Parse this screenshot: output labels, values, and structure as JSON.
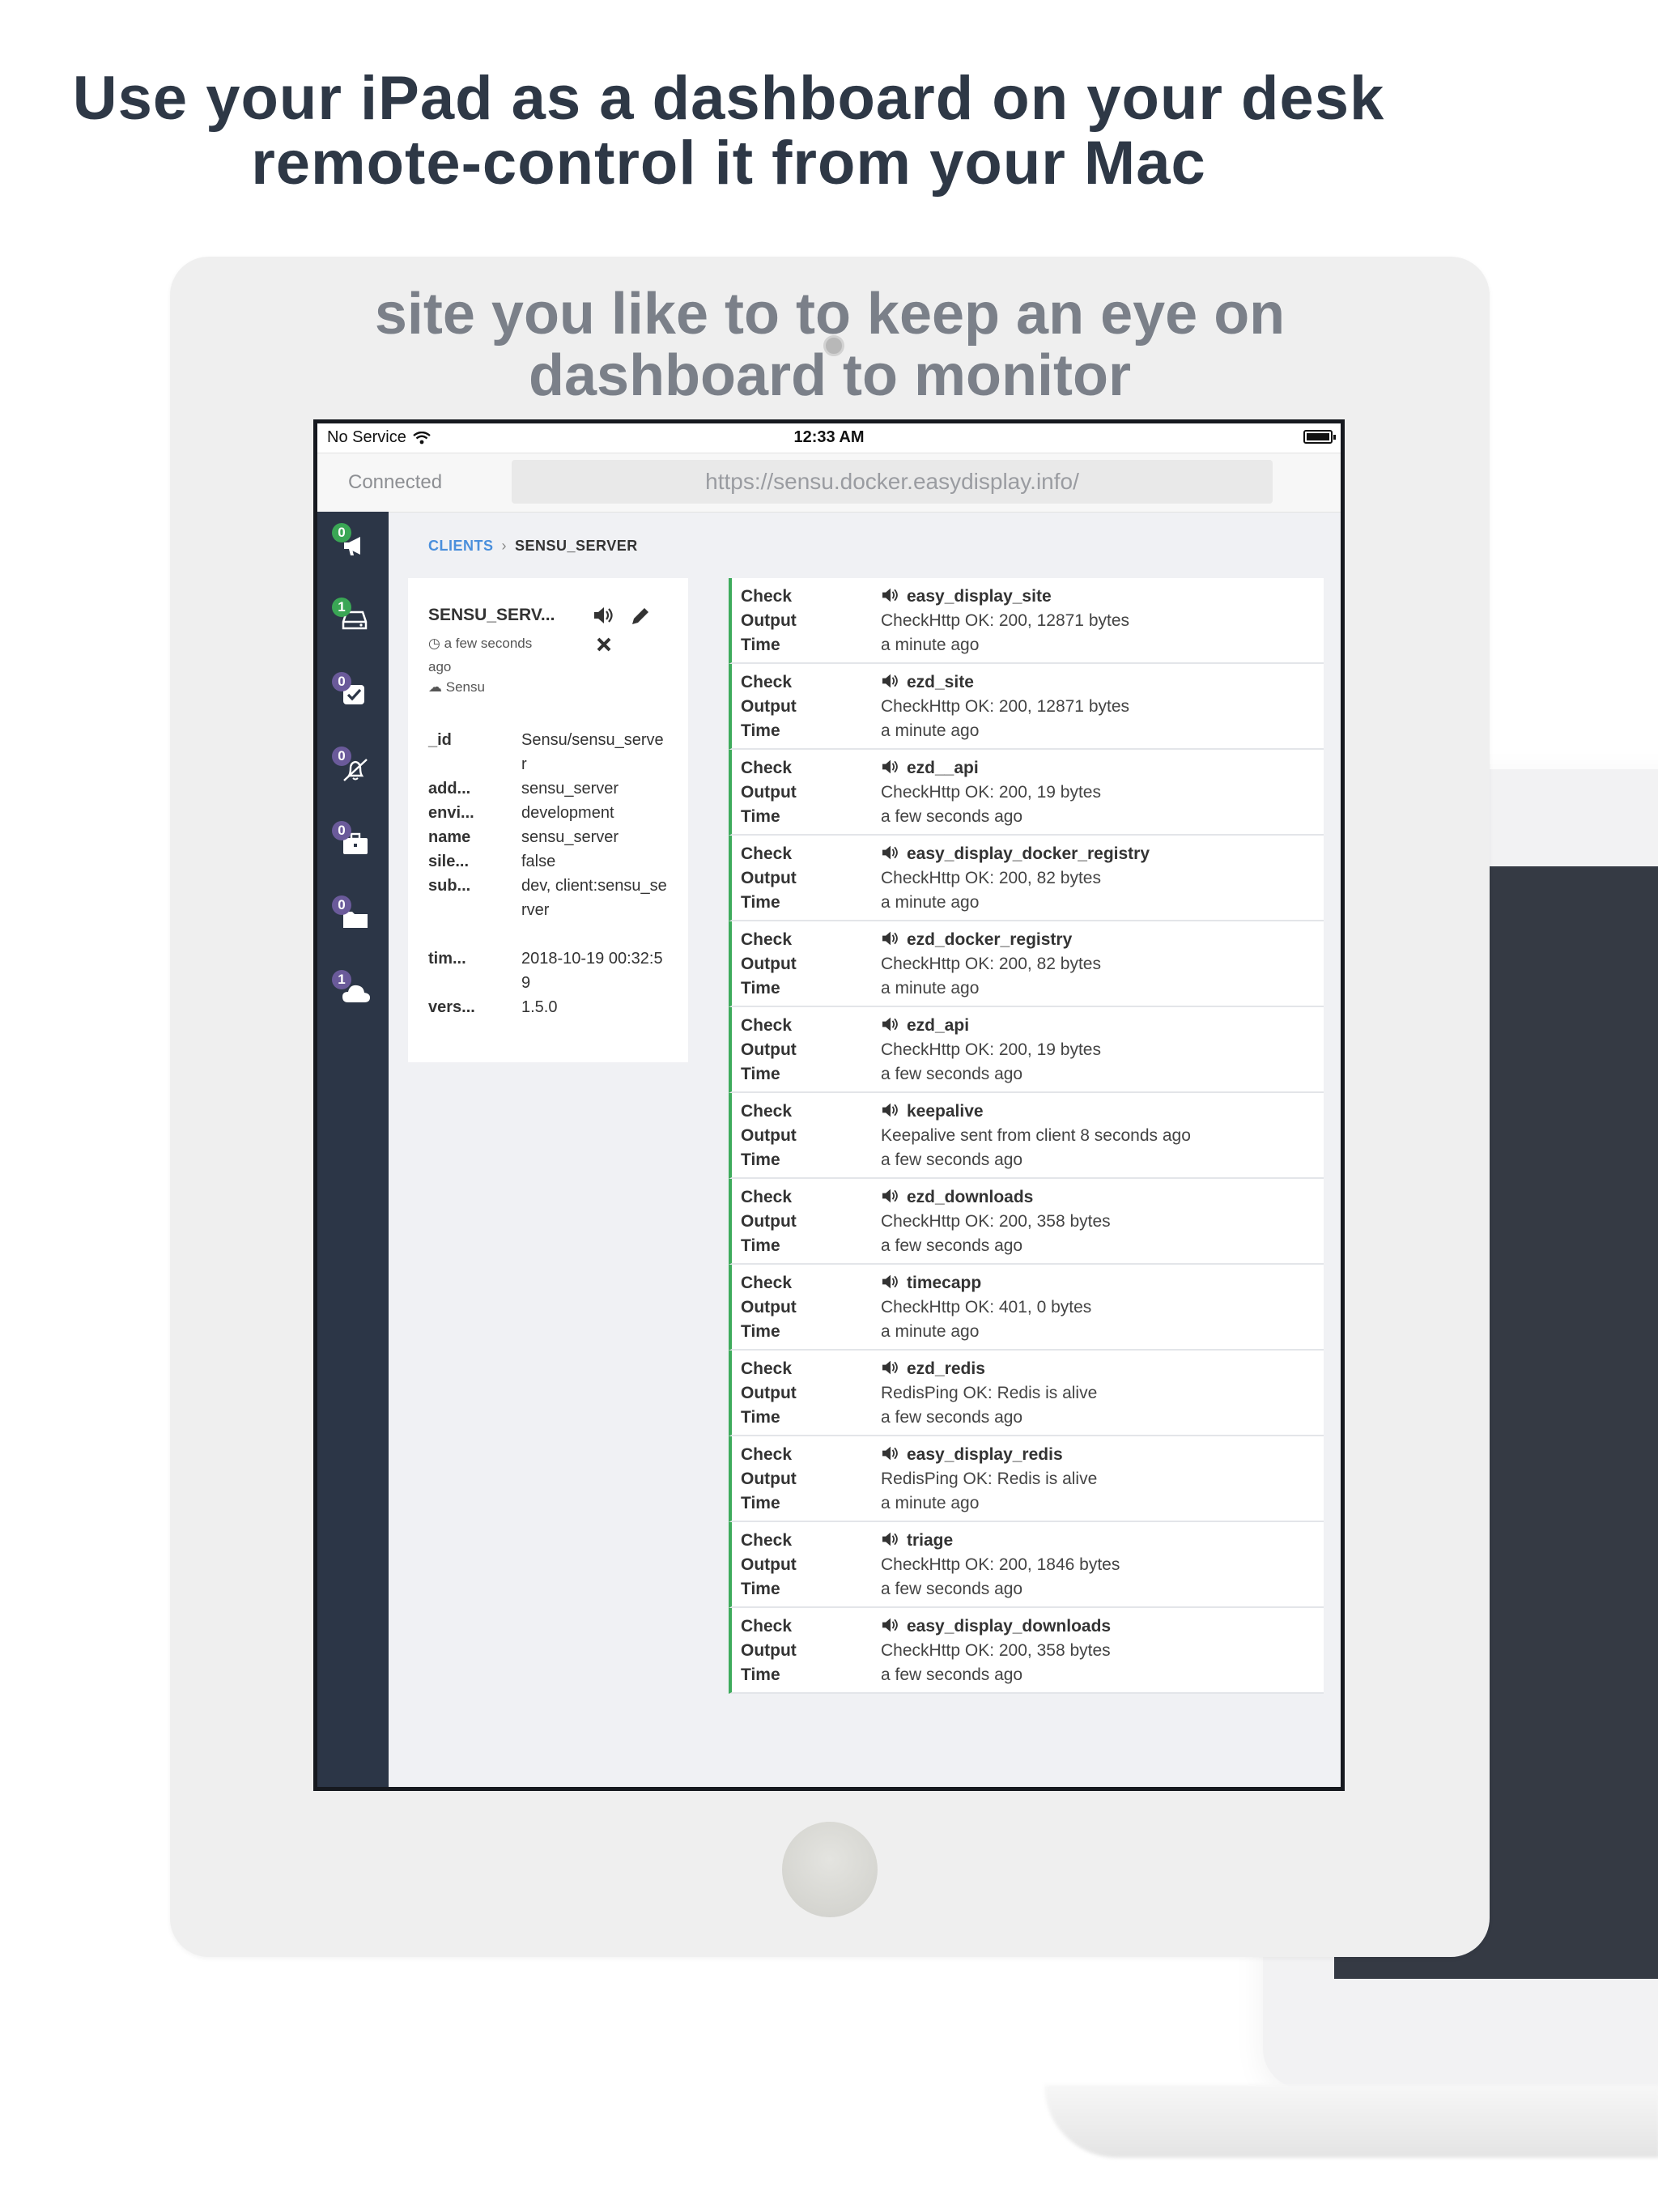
{
  "headline": {
    "line1": "Use your iPad as a dashboard on your desk",
    "line2": "remote-control it from your Mac"
  },
  "tagline": {
    "line1": "site you like to to keep an eye on",
    "line2": "dashboard to monitor"
  },
  "statusbar": {
    "carrier": "No Service",
    "time": "12:33 AM"
  },
  "browser": {
    "connection": "Connected",
    "url": "https://sensu.docker.easydisplay.info/"
  },
  "sidebar": {
    "items": [
      {
        "icon": "megaphone-icon",
        "badge": "0",
        "badge_color": "#3aa655"
      },
      {
        "icon": "hard-drive-icon",
        "badge": "1",
        "badge_color": "#3aa655"
      },
      {
        "icon": "checkbox-icon",
        "badge": "0",
        "badge_color": "#6a5a9a"
      },
      {
        "icon": "bell-slash-icon",
        "badge": "0",
        "badge_color": "#6a5a9a"
      },
      {
        "icon": "briefcase-icon",
        "badge": "0",
        "badge_color": "#6a5a9a"
      },
      {
        "icon": "folder-icon",
        "badge": "0",
        "badge_color": "#6a5a9a"
      },
      {
        "icon": "cloud-icon",
        "badge": "1",
        "badge_color": "#6a5a9a"
      }
    ]
  },
  "breadcrumb": {
    "parent": "CLIENTS",
    "current": "SENSU_SERVER"
  },
  "client": {
    "name": "SENSU_SERV...",
    "last_seen": "a few seconds ago",
    "source": "Sensu",
    "fields": [
      {
        "key": "_id",
        "value": "Sensu/sensu_server"
      },
      {
        "key": "add...",
        "value": "sensu_server"
      },
      {
        "key": "envi...",
        "value": "development"
      },
      {
        "key": "name",
        "value": "sensu_server"
      },
      {
        "key": "sile...",
        "value": "false"
      },
      {
        "key": "sub...",
        "value": "dev, client:sensu_server"
      },
      {
        "key": "tim...",
        "value": "2018-10-19 00:32:59"
      },
      {
        "key": "vers...",
        "value": "1.5.0"
      }
    ]
  },
  "check_labels": {
    "check": "Check",
    "output": "Output",
    "time": "Time"
  },
  "checks": [
    {
      "name": "easy_display_site",
      "output": "CheckHttp OK: 200, 12871 bytes",
      "time": "a minute ago"
    },
    {
      "name": "ezd_site",
      "output": "CheckHttp OK: 200, 12871 bytes",
      "time": "a minute ago"
    },
    {
      "name": "ezd__api",
      "output": "CheckHttp OK: 200, 19 bytes",
      "time": "a few seconds ago"
    },
    {
      "name": "easy_display_docker_registry",
      "output": "CheckHttp OK: 200, 82 bytes",
      "time": "a minute ago"
    },
    {
      "name": "ezd_docker_registry",
      "output": "CheckHttp OK: 200, 82 bytes",
      "time": "a minute ago"
    },
    {
      "name": "ezd_api",
      "output": "CheckHttp OK: 200, 19 bytes",
      "time": "a few seconds ago"
    },
    {
      "name": "keepalive",
      "output": "Keepalive sent from client 8 seconds ago",
      "time": "a few seconds ago"
    },
    {
      "name": "ezd_downloads",
      "output": "CheckHttp OK: 200, 358 bytes",
      "time": "a few seconds ago"
    },
    {
      "name": "timecapp",
      "output": "CheckHttp OK: 401, 0 bytes",
      "time": "a minute ago"
    },
    {
      "name": "ezd_redis",
      "output": "RedisPing OK: Redis is alive",
      "time": "a few seconds ago"
    },
    {
      "name": "easy_display_redis",
      "output": "RedisPing OK: Redis is alive",
      "time": "a minute ago"
    },
    {
      "name": "triage",
      "output": "CheckHttp OK: 200, 1846 bytes",
      "time": "a few seconds ago"
    },
    {
      "name": "easy_display_downloads",
      "output": "CheckHttp OK: 200, 358 bytes",
      "time": "a few seconds ago"
    }
  ],
  "colors": {
    "sidebar": "#2c3647",
    "check_ok": "#3eab5c",
    "link": "#4a8fdc"
  }
}
